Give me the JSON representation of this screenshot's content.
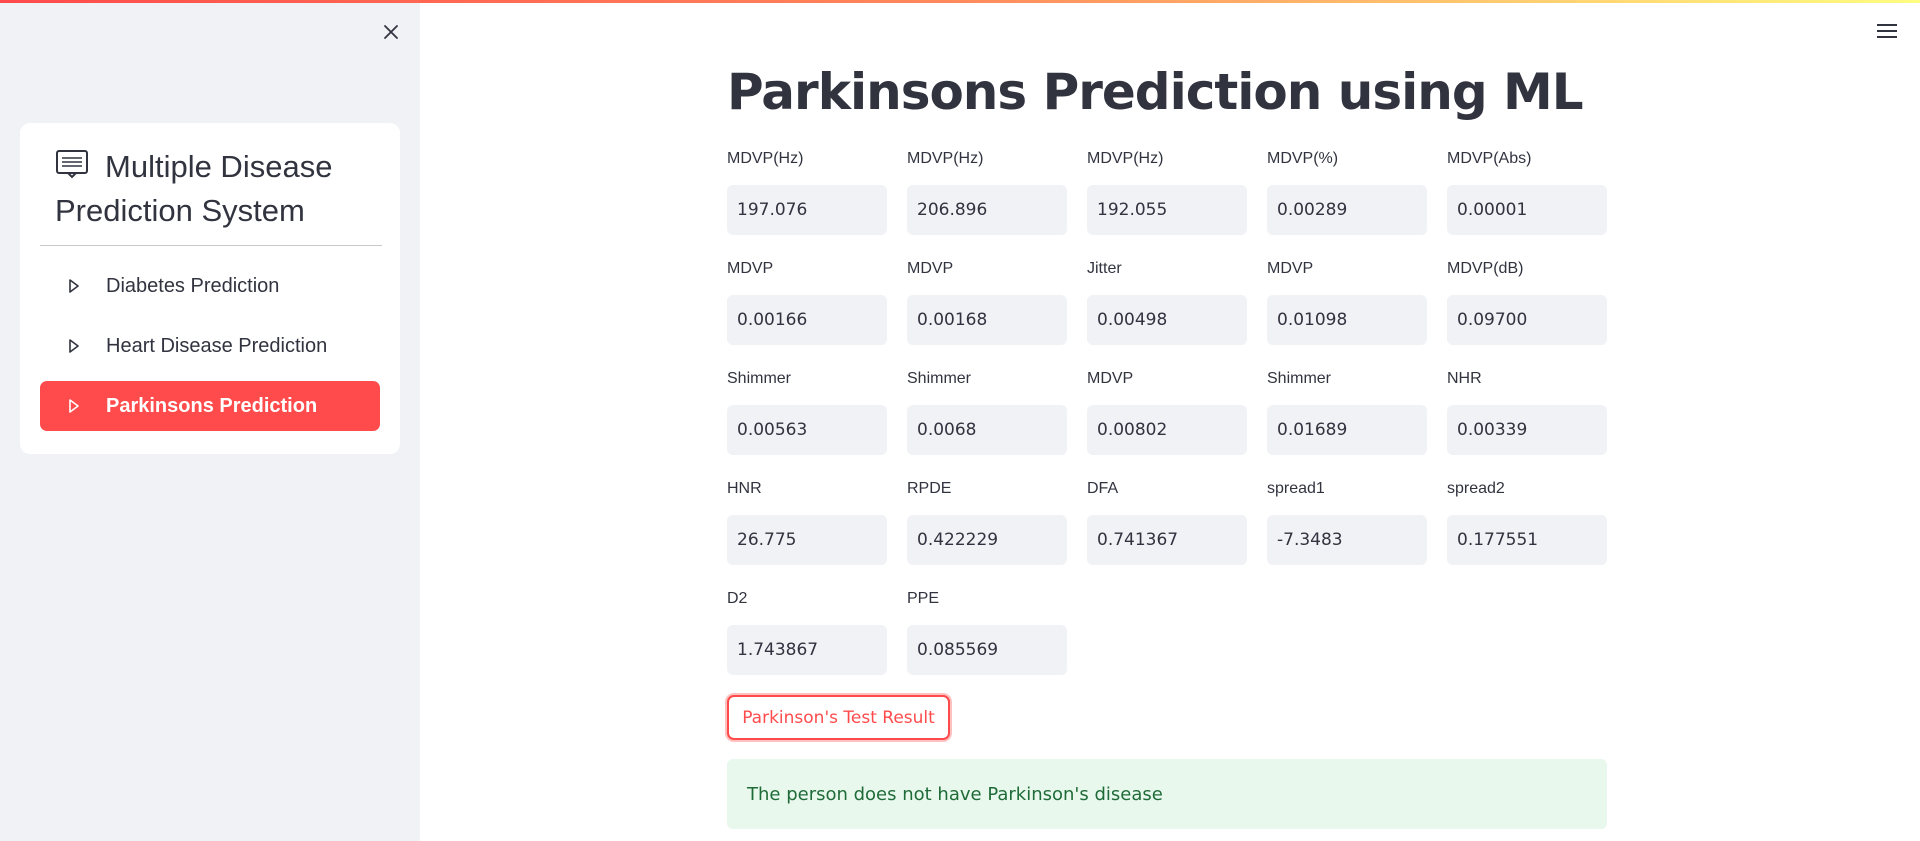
{
  "colors": {
    "accent": "#ff4b4b",
    "sidebar_bg": "#f0f2f6",
    "success_bg": "#e8f8ed",
    "success_text": "#1f6b38"
  },
  "sidebar": {
    "close_icon": "close-icon",
    "menu": {
      "title_icon": "list-card-icon",
      "title": "Multiple Disease Prediction System",
      "items": [
        {
          "label": "Diabetes Prediction",
          "icon": "play-triangle-icon",
          "active": false
        },
        {
          "label": "Heart Disease Prediction",
          "icon": "play-triangle-icon",
          "active": false
        },
        {
          "label": "Parkinsons Prediction",
          "icon": "play-triangle-icon",
          "active": true
        }
      ]
    }
  },
  "header": {
    "menu_icon": "hamburger-icon"
  },
  "main": {
    "title": "Parkinsons Prediction using ML",
    "fields": [
      {
        "label": "MDVP(Hz)",
        "value": "197.076"
      },
      {
        "label": "MDVP(Hz)",
        "value": "206.896"
      },
      {
        "label": "MDVP(Hz)",
        "value": "192.055"
      },
      {
        "label": "MDVP(%)",
        "value": "0.00289"
      },
      {
        "label": "MDVP(Abs)",
        "value": "0.00001"
      },
      {
        "label": "MDVP",
        "value": "0.00166"
      },
      {
        "label": "MDVP",
        "value": "0.00168"
      },
      {
        "label": "Jitter",
        "value": "0.00498"
      },
      {
        "label": "MDVP",
        "value": "0.01098"
      },
      {
        "label": "MDVP(dB)",
        "value": "0.09700"
      },
      {
        "label": "Shimmer",
        "value": "0.00563"
      },
      {
        "label": "Shimmer",
        "value": "0.0068"
      },
      {
        "label": "MDVP",
        "value": "0.00802"
      },
      {
        "label": "Shimmer",
        "value": "0.01689"
      },
      {
        "label": "NHR",
        "value": "0.00339"
      },
      {
        "label": "HNR",
        "value": "26.775"
      },
      {
        "label": "RPDE",
        "value": "0.422229"
      },
      {
        "label": "DFA",
        "value": "0.741367"
      },
      {
        "label": "spread1",
        "value": "-7.3483"
      },
      {
        "label": "spread2",
        "value": "0.177551"
      },
      {
        "label": "D2",
        "value": "1.743867"
      },
      {
        "label": "PPE",
        "value": "0.085569"
      }
    ],
    "button_label": "Parkinson's Test Result",
    "result_text": "The person does not have Parkinson's disease"
  }
}
